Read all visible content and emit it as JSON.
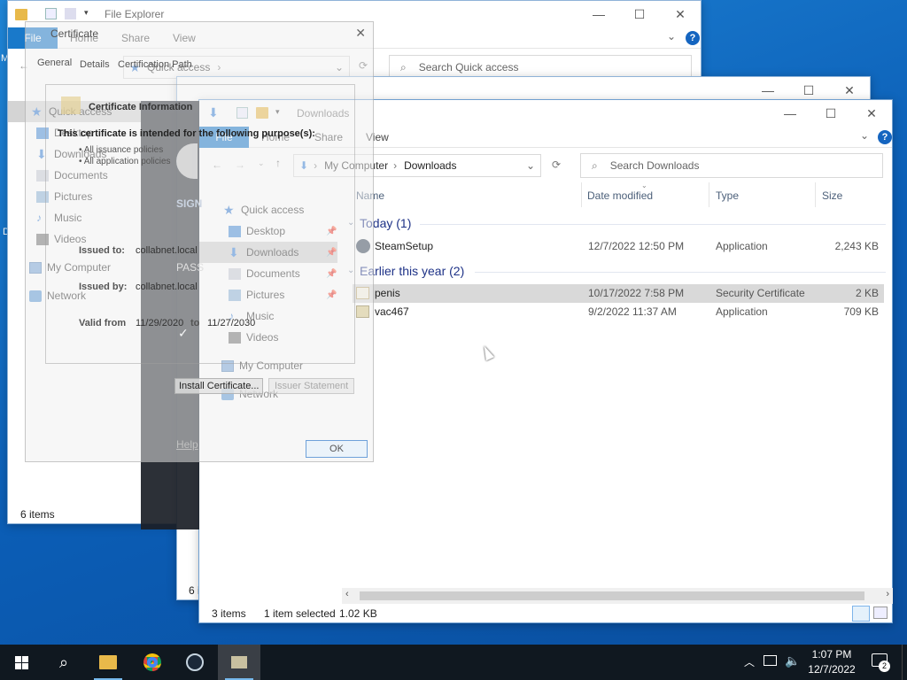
{
  "back_explorer": {
    "title": "File Explorer",
    "ribbon": {
      "file": "File",
      "home": "Home",
      "share": "Share",
      "view": "View"
    },
    "address": "Quick access",
    "search_placeholder": "Search Quick access",
    "nav": [
      "Quick access",
      "Desktop",
      "Downloads",
      "Documents",
      "Pictures",
      "Music",
      "Videos",
      "My Computer",
      "Network"
    ],
    "status": "6 items"
  },
  "middle_explorer": {
    "status_partial": "6 i"
  },
  "certificate": {
    "title": "Certificate",
    "tabs": [
      "General",
      "Details",
      "Certification Path"
    ],
    "heading": "Certificate Information",
    "purpose": "This certificate is intended for the following purpose(s):",
    "bullets": [
      "• All issuance policies",
      "• All application policies"
    ],
    "issued_to_label": "Issued to:",
    "issued_to": "collabnet.local",
    "issued_by_label": "Issued by:",
    "issued_by": "collabnet.local",
    "valid_from_label": "Valid from",
    "valid_from": "11/29/2020",
    "to_label": "to",
    "valid_to": "11/27/2030",
    "install_btn": "Install Certificate...",
    "issuer_btn": "Issuer Statement",
    "ok": "OK"
  },
  "steam": {
    "sign": "SIGN",
    "pass": "PASS",
    "help": "Help"
  },
  "front_explorer": {
    "title": "Downloads",
    "ribbon": {
      "file": "File",
      "home": "Home",
      "share": "Share",
      "view": "View"
    },
    "breadcrumb": [
      "My Computer",
      "Downloads"
    ],
    "search_placeholder": "Search Downloads",
    "nav": [
      "Quick access",
      "Desktop",
      "Downloads",
      "Documents",
      "Pictures",
      "Music",
      "Videos",
      "My Computer",
      "Network"
    ],
    "columns": {
      "name": "Name",
      "date": "Date modified",
      "type": "Type",
      "size": "Size"
    },
    "groups": {
      "today": "Today (1)",
      "earlier": "Earlier this year (2)"
    },
    "files": [
      {
        "name": "SteamSetup",
        "date": "12/7/2022 12:50 PM",
        "type": "Application",
        "size": "2,243 KB"
      },
      {
        "name": "penis",
        "date": "10/17/2022 7:58 PM",
        "type": "Security Certificate",
        "size": "2 KB"
      },
      {
        "name": "vac467",
        "date": "9/2/2022 11:37 AM",
        "type": "Application",
        "size": "709 KB"
      }
    ],
    "status": {
      "count": "3 items",
      "selected": "1 item selected",
      "size": "1.02 KB"
    }
  },
  "taskbar": {
    "time": "1:07 PM",
    "date": "12/7/2022",
    "notifications": "2"
  },
  "desktop_edge": {
    "m": "M",
    "d": "D"
  },
  "colors": {
    "accent": "#1979ca",
    "selected_row": "#cce8ff",
    "taskbar": "#101820"
  }
}
